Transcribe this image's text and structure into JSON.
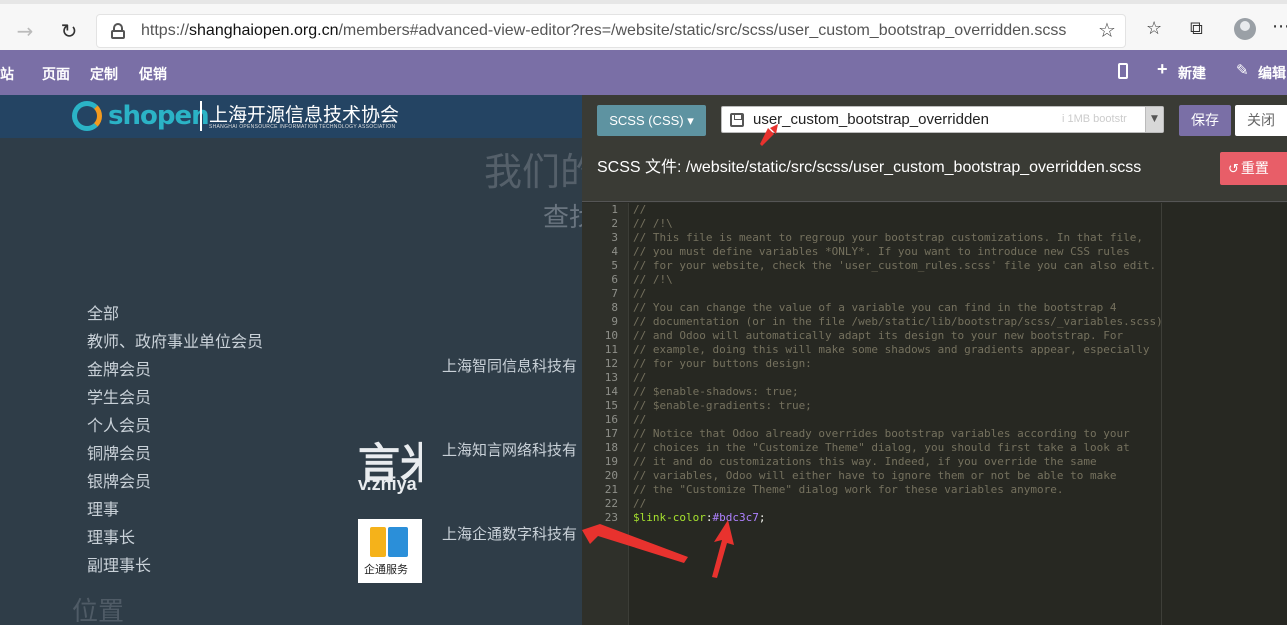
{
  "browser": {
    "url_prefix": "https://",
    "url_host": "shanghaiopen.org.cn",
    "url_path": "/members#advanced-view-editor?res=/website/static/src/scss/user_custom_bootstrap_overridden.scss",
    "icons": [
      "back-arrow-icon",
      "reload-icon",
      "lock-icon",
      "star-icon",
      "favorites-icon",
      "collections-icon",
      "avatar",
      "more-icon"
    ]
  },
  "topnav": {
    "items": [
      "站",
      "页面",
      "定制",
      "促销"
    ],
    "new_label": "新建",
    "edit_label": "编辑"
  },
  "site": {
    "logo_word": "shopen",
    "logo_cn": "上海开源信息技术协会",
    "logo_en": "SHANGHAI OPENSOURCE INFORMATION TECHNOLOGY ASSOCIATION",
    "big_title": "我们的",
    "sub_title": "查找",
    "categories": [
      "全部",
      "教师、政府事业单位会员",
      "金牌会员",
      "学生会员",
      "个人会员",
      "铜牌会员",
      "银牌会员",
      "理事",
      "理事长",
      "副理事长"
    ],
    "companies": [
      "上海智同信息科技有",
      "上海知言网络科技有",
      "上海企通数字科技有"
    ],
    "zhiyan_big": "言米",
    "zhiyan_small": "v.zhiya",
    "qitong_text": "企通服务",
    "position_title": "位置"
  },
  "editor": {
    "mode_label": "SCSS (CSS)",
    "file_name": "user_custom_bootstrap_overridden",
    "ghost_text": "i  1MB  bootstr",
    "save_label": "保存",
    "close_label": "关闭",
    "file_path": "SCSS 文件: /website/static/src/scss/user_custom_bootstrap_overridden.scss",
    "reset_label": "重置",
    "lines": [
      "//",
      "// /!\\",
      "// This file is meant to regroup your bootstrap customizations. In that file,",
      "// you must define variables *ONLY*. If you want to introduce new CSS rules",
      "// for your website, check the 'user_custom_rules.scss' file you can also edit.",
      "// /!\\",
      "//",
      "// You can change the value of a variable you can find in the bootstrap 4",
      "// documentation (or in the file /web/static/lib/bootstrap/scss/_variables.scss)",
      "// and Odoo will automatically adapt its design to your new bootstrap. For",
      "// example, doing this will make some shadows and gradients appear, especially",
      "// for your buttons design:",
      "//",
      "// $enable-shadows: true;",
      "// $enable-gradients: true;",
      "//",
      "// Notice that Odoo already overrides bootstrap variables according to your",
      "// choices in the \"Customize Theme\" dialog, you should first take a look at",
      "// it and do customizations this way. Indeed, if you override the same",
      "// variables, Odoo will either have to ignore them or not be able to make",
      "// the \"Customize Theme\" dialog work for these variables anymore.",
      "//"
    ],
    "last_line": {
      "variable": "$link-color",
      "colon": ":",
      "value": "#bdc3c7",
      "semicolon": ";"
    }
  },
  "colors": {
    "odoo_purple": "#7a6fa6",
    "reset_red": "#e85e68",
    "mode_teal": "#5e93a1",
    "annotation_red": "#e8322e"
  }
}
